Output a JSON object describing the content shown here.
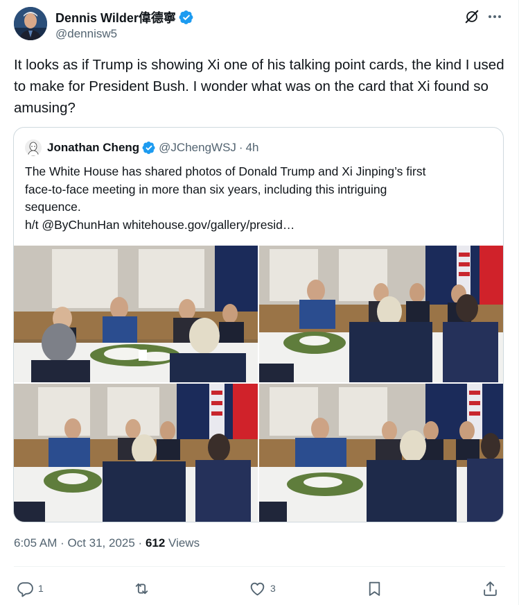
{
  "tweet": {
    "author": {
      "display_name": "Dennis Wilder偉德寧",
      "handle": "@dennisw5",
      "verified": true
    },
    "text": "It looks as if Trump is showing Xi one of his talking point cards, the kind I used to make for President Bush. I wonder what was on the card that Xi found so amusing?",
    "timestamp": "6:05 AM · Oct 31, 2025 · ",
    "views_count": "612",
    "views_label": " Views"
  },
  "quoted": {
    "author": {
      "display_name": "Jonathan Cheng",
      "handle": "@JChengWSJ",
      "verified": true
    },
    "separator": "·",
    "time_ago": "4h",
    "lines": [
      "The White House has shared photos of Donald Trump and Xi Jinping’s first",
      "face-to-face meeting in more than six years, including this intriguing",
      "sequence.",
      "h/t @ByChunHan whitehouse.gov/gallery/presid…"
    ],
    "photo_count": 4
  },
  "actions": {
    "reply_count": "1",
    "retweet_count": "",
    "like_count": "3"
  },
  "icons": {
    "verified": "verified-badge-icon",
    "grok": "grok-icon",
    "more": "more-icon",
    "reply": "reply-icon",
    "retweet": "retweet-icon",
    "like": "heart-icon",
    "bookmark": "bookmark-icon",
    "share": "share-icon"
  },
  "colors": {
    "text_primary": "#0f1419",
    "text_secondary": "#536471",
    "verified_blue": "#1d9bf0",
    "border": "#cfd9de"
  }
}
